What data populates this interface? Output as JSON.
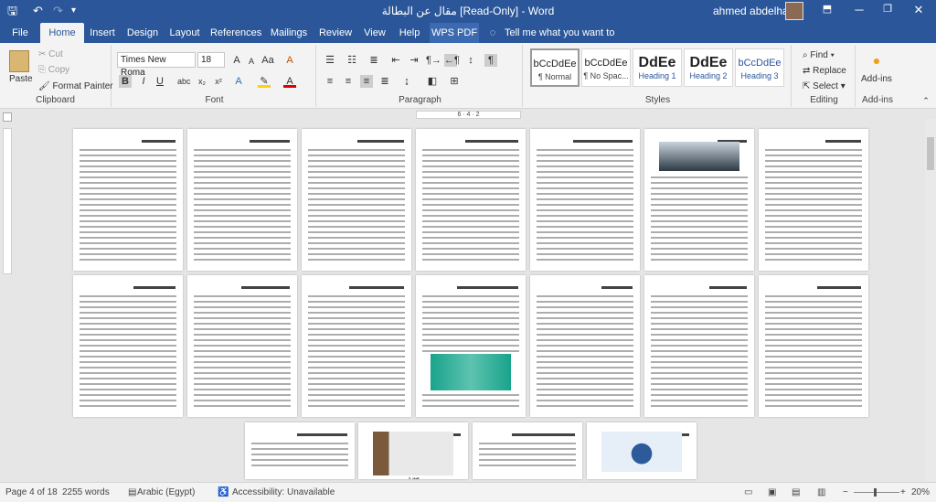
{
  "window": {
    "title": "مقال عن البطالة [Read-Only]  -  Word",
    "user": "ahmed abdelhady"
  },
  "tabs": [
    "File",
    "Home",
    "Insert",
    "Design",
    "Layout",
    "References",
    "Mailings",
    "Review",
    "View",
    "Help",
    "WPS PDF"
  ],
  "tell_me": "Tell me what you want to do",
  "clipboard": {
    "paste": "Paste",
    "cut": "Cut",
    "copy": "Copy",
    "painter": "Format Painter",
    "label": "Clipboard"
  },
  "font": {
    "name": "Times New Roma",
    "size": "18",
    "label": "Font"
  },
  "paragraph": {
    "label": "Paragraph"
  },
  "styles": {
    "label": "Styles",
    "items": [
      {
        "preview": "bCcDdEe",
        "name": "¶ Normal"
      },
      {
        "preview": "bCcDdEe",
        "name": "¶ No Spac..."
      },
      {
        "preview": "DdEe",
        "name": "Heading 1"
      },
      {
        "preview": "DdEe",
        "name": "Heading 2"
      },
      {
        "preview": "bCcDdEe",
        "name": "Heading 3"
      }
    ]
  },
  "editing": {
    "find": "Find",
    "replace": "Replace",
    "select": "Select",
    "label": "Editing"
  },
  "addins": {
    "label": "Add-ins",
    "button": "Add-ins"
  },
  "ruler": "6 · 4 · 2",
  "page_labels": {
    "pic_caption": "صورة"
  },
  "status": {
    "page": "Page 4 of 18",
    "words": "2255 words",
    "language": "Arabic (Egypt)",
    "accessibility": "Accessibility: Unavailable",
    "zoom": "20%"
  },
  "colors": {
    "accent": "#2b579a",
    "highlight": "#ffd200",
    "font_color": "#e00000"
  }
}
